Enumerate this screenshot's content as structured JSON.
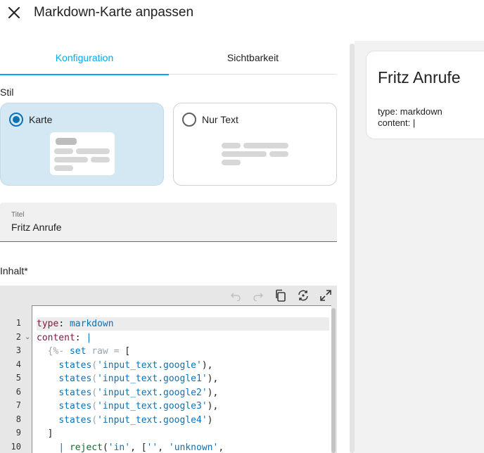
{
  "dialog": {
    "title": "Markdown-Karte anpassen",
    "close_icon": "close-icon"
  },
  "tabs": [
    {
      "label": "Konfiguration",
      "active": true
    },
    {
      "label": "Sichtbarkeit",
      "active": false
    }
  ],
  "style_section": {
    "label": "Stil",
    "options": [
      {
        "label": "Karte",
        "selected": true
      },
      {
        "label": "Nur Text",
        "selected": false
      }
    ]
  },
  "title_field": {
    "label": "Titel",
    "value": "Fritz Anrufe"
  },
  "content_section": {
    "label": "Inhalt*",
    "toolbar_icons": [
      "undo-icon",
      "redo-icon",
      "copy-icon",
      "sync-icon",
      "fullscreen-icon"
    ],
    "line_numbers": [
      "1",
      "2",
      "3",
      "4",
      "5",
      "6",
      "7",
      "8",
      "9",
      "10"
    ],
    "fold_marker": "⌄",
    "lines": [
      {
        "parts": [
          {
            "c": "k",
            "t": "type"
          },
          {
            "c": "",
            "t": ": "
          },
          {
            "c": "b",
            "t": "markdown"
          }
        ]
      },
      {
        "parts": [
          {
            "c": "k",
            "t": "content"
          },
          {
            "c": "",
            "t": ": "
          },
          {
            "c": "b",
            "t": "|"
          }
        ]
      },
      {
        "parts": [
          {
            "c": "",
            "t": "  "
          },
          {
            "c": "g",
            "t": "{%-"
          },
          {
            "c": "",
            "t": " "
          },
          {
            "c": "b",
            "t": "set"
          },
          {
            "c": "",
            "t": " "
          },
          {
            "c": "g",
            "t": "raw"
          },
          {
            "c": "",
            "t": " "
          },
          {
            "c": "g",
            "t": "="
          },
          {
            "c": "",
            "t": " ["
          }
        ]
      },
      {
        "parts": [
          {
            "c": "",
            "t": "    "
          },
          {
            "c": "b",
            "t": "states"
          },
          {
            "c": "g",
            "t": "("
          },
          {
            "c": "b",
            "t": "'input_text.google'"
          },
          {
            "c": "",
            "t": "),"
          }
        ]
      },
      {
        "parts": [
          {
            "c": "",
            "t": "    "
          },
          {
            "c": "b",
            "t": "states"
          },
          {
            "c": "g",
            "t": "("
          },
          {
            "c": "b",
            "t": "'input_text.google1'"
          },
          {
            "c": "",
            "t": "),"
          }
        ]
      },
      {
        "parts": [
          {
            "c": "",
            "t": "    "
          },
          {
            "c": "b",
            "t": "states"
          },
          {
            "c": "g",
            "t": "("
          },
          {
            "c": "b",
            "t": "'input_text.google2'"
          },
          {
            "c": "",
            "t": "),"
          }
        ]
      },
      {
        "parts": [
          {
            "c": "",
            "t": "    "
          },
          {
            "c": "b",
            "t": "states"
          },
          {
            "c": "g",
            "t": "("
          },
          {
            "c": "b",
            "t": "'input_text.google3'"
          },
          {
            "c": "",
            "t": "),"
          }
        ]
      },
      {
        "parts": [
          {
            "c": "",
            "t": "    "
          },
          {
            "c": "b",
            "t": "states"
          },
          {
            "c": "g",
            "t": "("
          },
          {
            "c": "b",
            "t": "'input_text.google4'"
          },
          {
            "c": "",
            "t": ")"
          }
        ]
      },
      {
        "parts": [
          {
            "c": "",
            "t": "  ]"
          }
        ]
      },
      {
        "parts": [
          {
            "c": "",
            "t": "    "
          },
          {
            "c": "b",
            "t": "|"
          },
          {
            "c": "",
            "t": " "
          },
          {
            "c": "s",
            "t": "reject"
          },
          {
            "c": "",
            "t": "("
          },
          {
            "c": "b",
            "t": "'in'"
          },
          {
            "c": "",
            "t": ", ["
          },
          {
            "c": "b",
            "t": "''"
          },
          {
            "c": "",
            "t": ", "
          },
          {
            "c": "b",
            "t": "'unknown'"
          },
          {
            "c": "",
            "t": ","
          }
        ]
      }
    ]
  },
  "preview": {
    "card_title": "Fritz Anrufe",
    "card_body": "type: markdown\ncontent: |"
  },
  "colors": {
    "accent": "#03a9f4",
    "selected_card_bg": "#d4e8f3",
    "yaml_key": "#8c1342",
    "yaml_value": "#0b72b5",
    "jinja_delim": "#9aa5b0",
    "filter": "#116b2f"
  }
}
